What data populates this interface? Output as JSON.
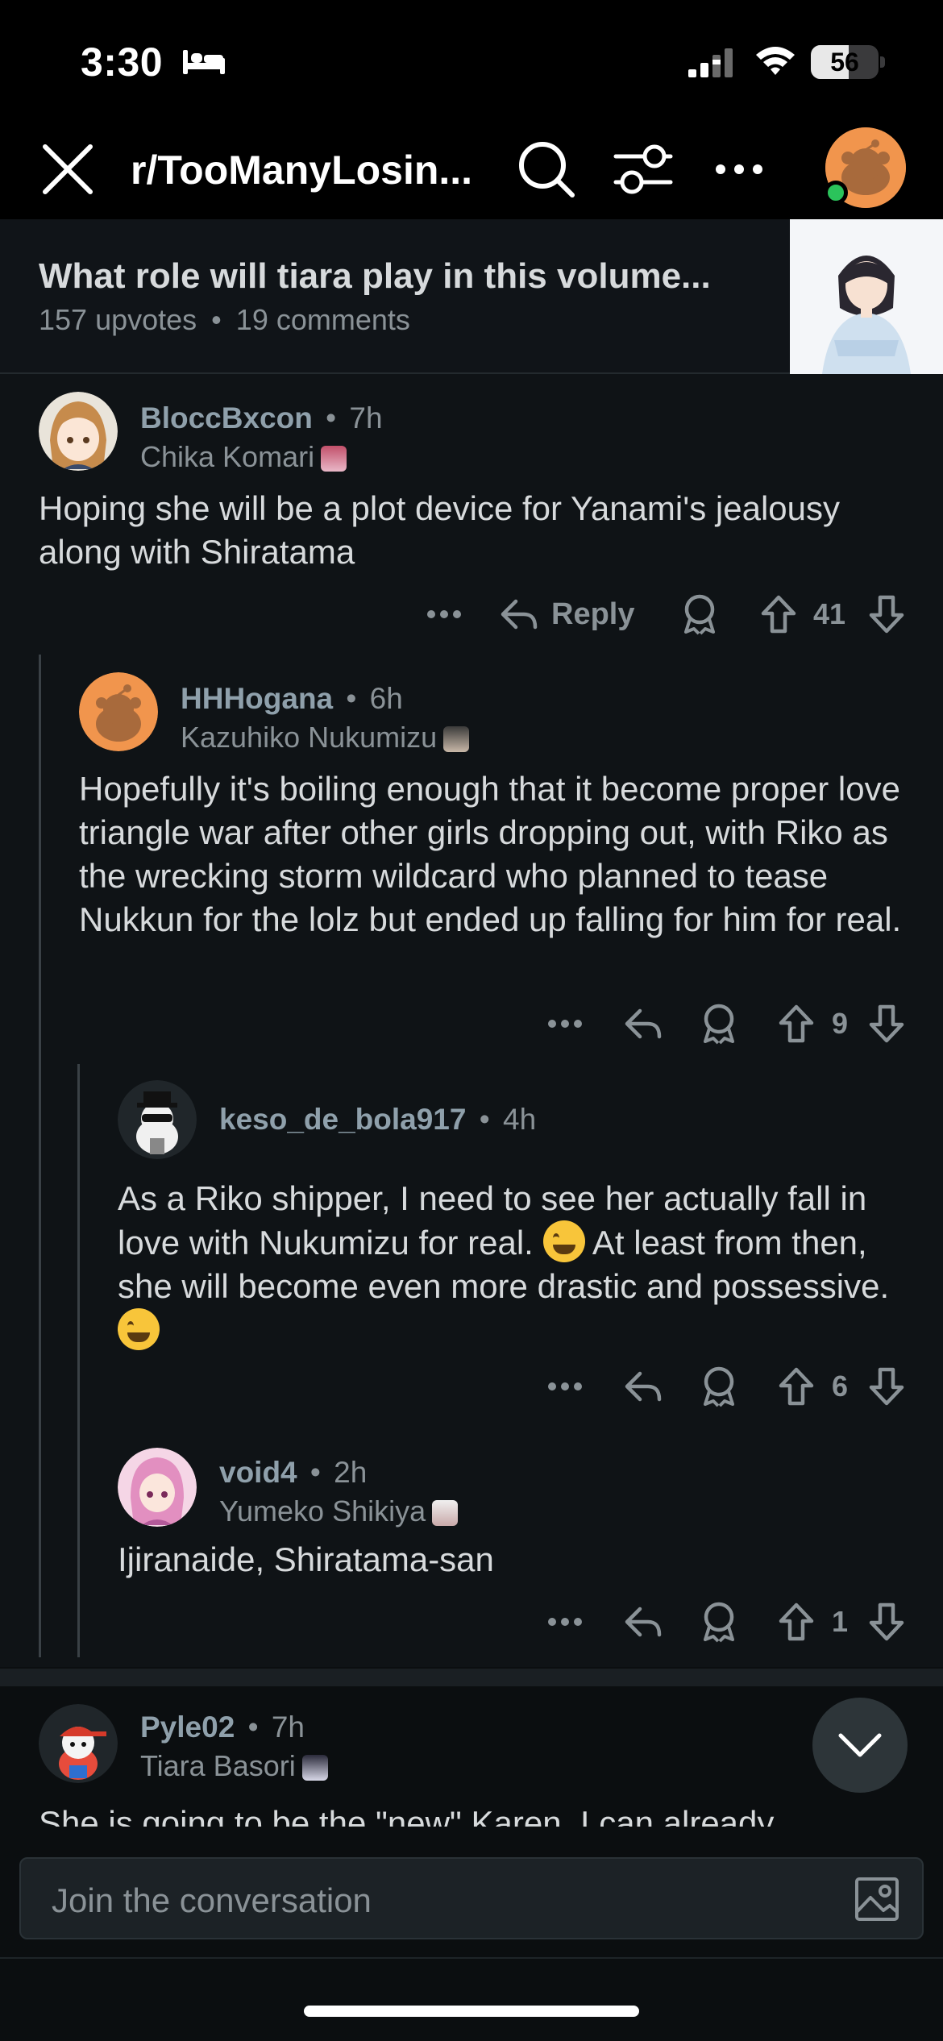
{
  "status_bar": {
    "time": "3:30",
    "battery": "56",
    "battery_level": 0.56
  },
  "header": {
    "subreddit": "r/TooManyLosin..."
  },
  "post": {
    "title": "What role will tiara play in this volume...",
    "upvotes": "157 upvotes",
    "comments": "19 comments",
    "separator": "•"
  },
  "comments": [
    {
      "username": "BloccBxcon",
      "age": "7h",
      "flair": "Chika Komari",
      "body": "Hoping she will be a plot device for Yanami's jealousy along with Shiratama",
      "reply_label": "Reply",
      "votes": "41"
    },
    {
      "username": "HHHogana",
      "age": "6h",
      "flair": "Kazuhiko Nukumizu",
      "body": "Hopefully it's boiling enough that it become proper love triangle war after other girls dropping out, with Riko as the wrecking storm wildcard who planned to tease Nukkun for the lolz but ended up falling for him for real.",
      "votes": "9"
    },
    {
      "username": "keso_de_bola917",
      "age": "4h",
      "body_part1": "As a Riko shipper, I need to see her actually fall in love with Nukumizu for real.",
      "body_part2": "At least from then, she will become even more drastic and possessive.",
      "votes": "6"
    },
    {
      "username": "void4",
      "age": "2h",
      "flair": "Yumeko Shikiya",
      "body": "Ijiranaide, Shiratama-san",
      "votes": "1"
    },
    {
      "username": "Pyle02",
      "age": "7h",
      "flair": "Tiara Basori",
      "body": "She is going to be the \"new\" Karen. I can already"
    }
  ],
  "composer": {
    "placeholder": "Join the conversation"
  },
  "colors": {
    "background": "#0f1316",
    "header": "#000000",
    "username": "#8fa0ab",
    "meta": "#8a9297",
    "text": "#d7dadc",
    "avatar_orange": "#f1954d",
    "online_green": "#2bc35b"
  },
  "icons": [
    "close-icon",
    "search-icon",
    "filter-icon",
    "more-icon",
    "reply-icon",
    "award-icon",
    "upvote-icon",
    "downvote-icon",
    "chevron-down-icon",
    "image-icon"
  ]
}
